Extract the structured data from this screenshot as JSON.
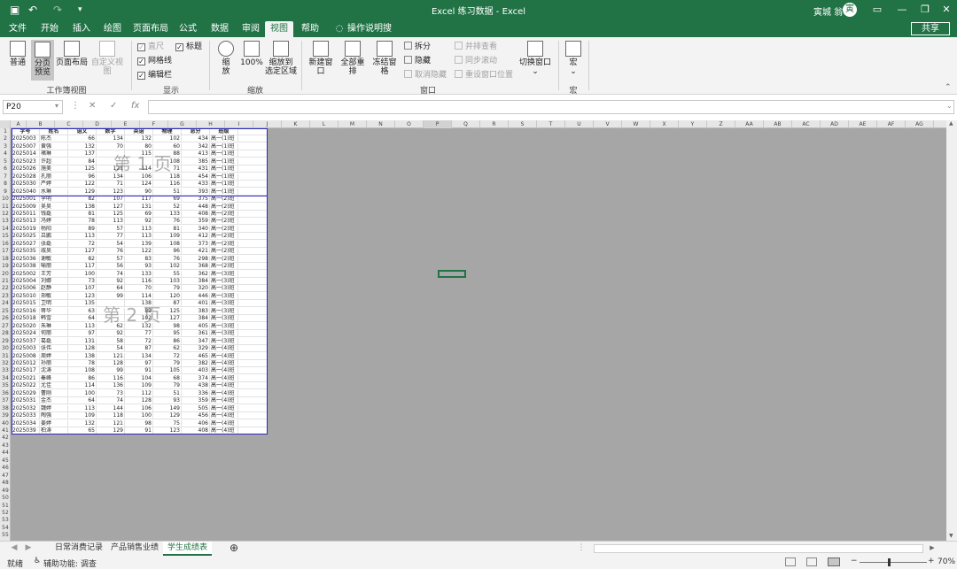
{
  "titlebar": {
    "title": "Excel 练习数据  -  Excel",
    "user": "寅城 翁",
    "avatar": "寅"
  },
  "tabs": [
    "文件",
    "开始",
    "插入",
    "绘图",
    "页面布局",
    "公式",
    "数据",
    "审阅",
    "视图",
    "帮助",
    "操作说明搜索"
  ],
  "share": "共享",
  "ribbon": {
    "normal": "普通",
    "pagebreak1": "分页",
    "pagebreak2": "预览",
    "pagelayout": "页面布局",
    "customview": "自定义视图",
    "ruler": "直尺",
    "gridlines": "网格线",
    "formulabar": "编辑栏",
    "headings": "标题",
    "zoom1": "缩",
    "zoom2": "放",
    "zoom100": "100%",
    "zoomsel1": "缩放到",
    "zoomsel2": "选定区域",
    "newwin": "新建窗口",
    "arrange": "全部重排",
    "freeze": "冻结窗格",
    "split": "拆分",
    "hide": "隐藏",
    "unhide": "取消隐藏",
    "sidebyside": "并排查看",
    "syncscroll": "同步滚动",
    "resetpos": "重设窗口位置",
    "switchwin": "切换窗口",
    "macro": "宏",
    "g_workbook": "工作簿视图",
    "g_show": "显示",
    "g_zoom": "缩放",
    "g_window": "窗口",
    "g_macro": "宏"
  },
  "formula": {
    "namebox": "P20",
    "fx": "fx"
  },
  "columns": [
    "A",
    "B",
    "C",
    "D",
    "E",
    "F",
    "G",
    "H",
    "I",
    "J",
    "K",
    "L",
    "M",
    "N",
    "O",
    "P",
    "Q",
    "R",
    "S",
    "T",
    "U",
    "V",
    "W",
    "X",
    "Y",
    "Z",
    "AA",
    "AB",
    "AC",
    "AD",
    "AE",
    "AF",
    "AG"
  ],
  "headers": [
    "学号",
    "姓名",
    "语文",
    "数学",
    "英语",
    "物理",
    "总分",
    "班级"
  ],
  "rows": [
    [
      "2025003",
      "陈杰",
      "66",
      "134",
      "132",
      "102",
      "434",
      "高一(1)班"
    ],
    [
      "2025007",
      "黄强",
      "132",
      "70",
      "80",
      "60",
      "342",
      "高一(1)班"
    ],
    [
      "2025014",
      "褚琳",
      "137",
      "",
      "115",
      "88",
      "413",
      "高一(1)班"
    ],
    [
      "2025023",
      "许超",
      "84",
      "",
      "",
      "108",
      "385",
      "高一(1)班"
    ],
    [
      "2025026",
      "施美",
      "125",
      "121",
      "114",
      "71",
      "431",
      "高一(1)班"
    ],
    [
      "2025028",
      "孔丽",
      "96",
      "134",
      "106",
      "118",
      "454",
      "高一(1)班"
    ],
    [
      "2025030",
      "严婷",
      "122",
      "71",
      "124",
      "116",
      "433",
      "高一(1)班"
    ],
    [
      "2025040",
      "水琳",
      "129",
      "123",
      "90",
      "51",
      "393",
      "高一(1)班"
    ],
    [
      "2025001",
      "李明",
      "82",
      "107",
      "117",
      "69",
      "375",
      "高一(2)班"
    ],
    [
      "2025009",
      "吴昊",
      "138",
      "127",
      "131",
      "52",
      "448",
      "高一(2)班"
    ],
    [
      "2025011",
      "钱磊",
      "81",
      "125",
      "69",
      "133",
      "408",
      "高一(2)班"
    ],
    [
      "2025013",
      "冯婷",
      "78",
      "113",
      "92",
      "76",
      "359",
      "高一(2)班"
    ],
    [
      "2025019",
      "杨阳",
      "89",
      "57",
      "113",
      "81",
      "340",
      "高一(2)班"
    ],
    [
      "2025025",
      "吕鹏",
      "113",
      "77",
      "113",
      "109",
      "412",
      "高一(2)班"
    ],
    [
      "2025027",
      "张磊",
      "72",
      "54",
      "139",
      "108",
      "373",
      "高一(2)班"
    ],
    [
      "2025035",
      "戚昊",
      "127",
      "76",
      "122",
      "96",
      "421",
      "高一(2)班"
    ],
    [
      "2025036",
      "谢敏",
      "82",
      "57",
      "83",
      "76",
      "298",
      "高一(2)班"
    ],
    [
      "2025038",
      "喻丽",
      "117",
      "56",
      "93",
      "102",
      "368",
      "高一(2)班"
    ],
    [
      "2025002",
      "王芳",
      "100",
      "74",
      "133",
      "55",
      "362",
      "高一(3)班"
    ],
    [
      "2025004",
      "刘娜",
      "73",
      "92",
      "116",
      "103",
      "384",
      "高一(3)班"
    ],
    [
      "2025006",
      "赵静",
      "107",
      "64",
      "70",
      "79",
      "320",
      "高一(3)班"
    ],
    [
      "2025010",
      "郑敏",
      "123",
      "99",
      "114",
      "120",
      "446",
      "高一(3)班"
    ],
    [
      "2025015",
      "卫明",
      "135",
      "",
      "138",
      "87",
      "401",
      "高一(3)班"
    ],
    [
      "2025016",
      "蒋华",
      "63",
      "",
      "89",
      "125",
      "383",
      "高一(3)班"
    ],
    [
      "2025018",
      "韩雪",
      "64",
      "",
      "102",
      "127",
      "384",
      "高一(3)班"
    ],
    [
      "2025020",
      "朱琳",
      "113",
      "62",
      "132",
      "98",
      "405",
      "高一(3)班"
    ],
    [
      "2025024",
      "何丽",
      "97",
      "92",
      "77",
      "95",
      "361",
      "高一(3)班"
    ],
    [
      "2025037",
      "葛磊",
      "131",
      "58",
      "72",
      "86",
      "347",
      "高一(3)班"
    ],
    [
      "2025003",
      "张伟",
      "128",
      "54",
      "87",
      "62",
      "329",
      "高一(4)班"
    ],
    [
      "2025008",
      "周婷",
      "138",
      "121",
      "134",
      "72",
      "465",
      "高一(4)班"
    ],
    [
      "2025012",
      "孙丽",
      "78",
      "128",
      "97",
      "79",
      "382",
      "高一(4)班"
    ],
    [
      "2025017",
      "沈涛",
      "108",
      "99",
      "91",
      "105",
      "403",
      "高一(4)班"
    ],
    [
      "2025021",
      "秦峰",
      "86",
      "116",
      "104",
      "68",
      "374",
      "高一(4)班"
    ],
    [
      "2025022",
      "尤佳",
      "114",
      "136",
      "109",
      "79",
      "438",
      "高一(4)班"
    ],
    [
      "2025029",
      "曹刚",
      "100",
      "73",
      "112",
      "51",
      "336",
      "高一(4)班"
    ],
    [
      "2025031",
      "金杰",
      "64",
      "74",
      "128",
      "93",
      "359",
      "高一(4)班"
    ],
    [
      "2025032",
      "魏婷",
      "113",
      "144",
      "106",
      "149",
      "505",
      "高一(4)班"
    ],
    [
      "2025033",
      "陶强",
      "109",
      "118",
      "100",
      "129",
      "456",
      "高一(4)班"
    ],
    [
      "2025034",
      "姜婷",
      "132",
      "121",
      "98",
      "75",
      "406",
      "高一(4)班"
    ],
    [
      "2025039",
      "柏涛",
      "65",
      "129",
      "91",
      "123",
      "408",
      "高一(4)班"
    ]
  ],
  "pages": [
    "第 1 页",
    "第 2 页"
  ],
  "sheettabs": [
    "日常消费记录",
    "产品销售业绩",
    "学生成绩表"
  ],
  "status": {
    "ready": "就绪",
    "accessibility": "辅助功能: 调查",
    "zoom": "70%"
  }
}
